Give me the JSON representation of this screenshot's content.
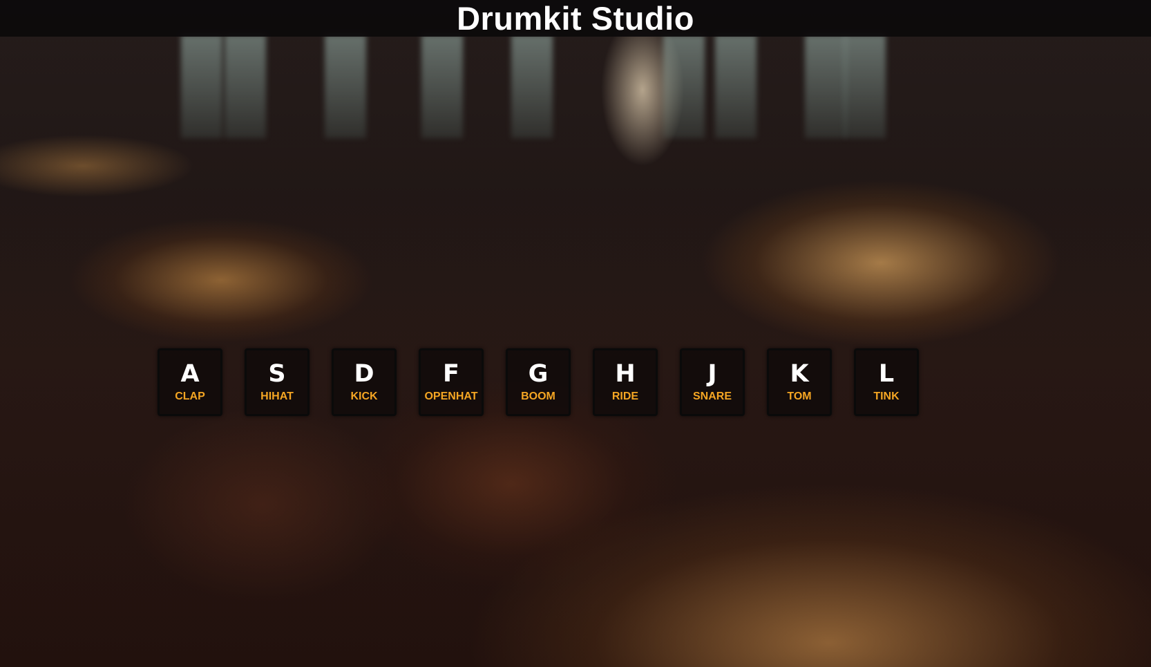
{
  "header": {
    "title": "Drumkit Studio"
  },
  "colors": {
    "accent": "#f5a623",
    "key_text": "#ffffff",
    "header_bg": "#0c0a0b"
  },
  "keys": [
    {
      "key": "A",
      "sound": "CLAP"
    },
    {
      "key": "S",
      "sound": "HIHAT"
    },
    {
      "key": "D",
      "sound": "KICK"
    },
    {
      "key": "F",
      "sound": "OPENHAT"
    },
    {
      "key": "G",
      "sound": "BOOM"
    },
    {
      "key": "H",
      "sound": "RIDE"
    },
    {
      "key": "J",
      "sound": "SNARE"
    },
    {
      "key": "K",
      "sound": "TOM"
    },
    {
      "key": "L",
      "sound": "TINK"
    }
  ]
}
